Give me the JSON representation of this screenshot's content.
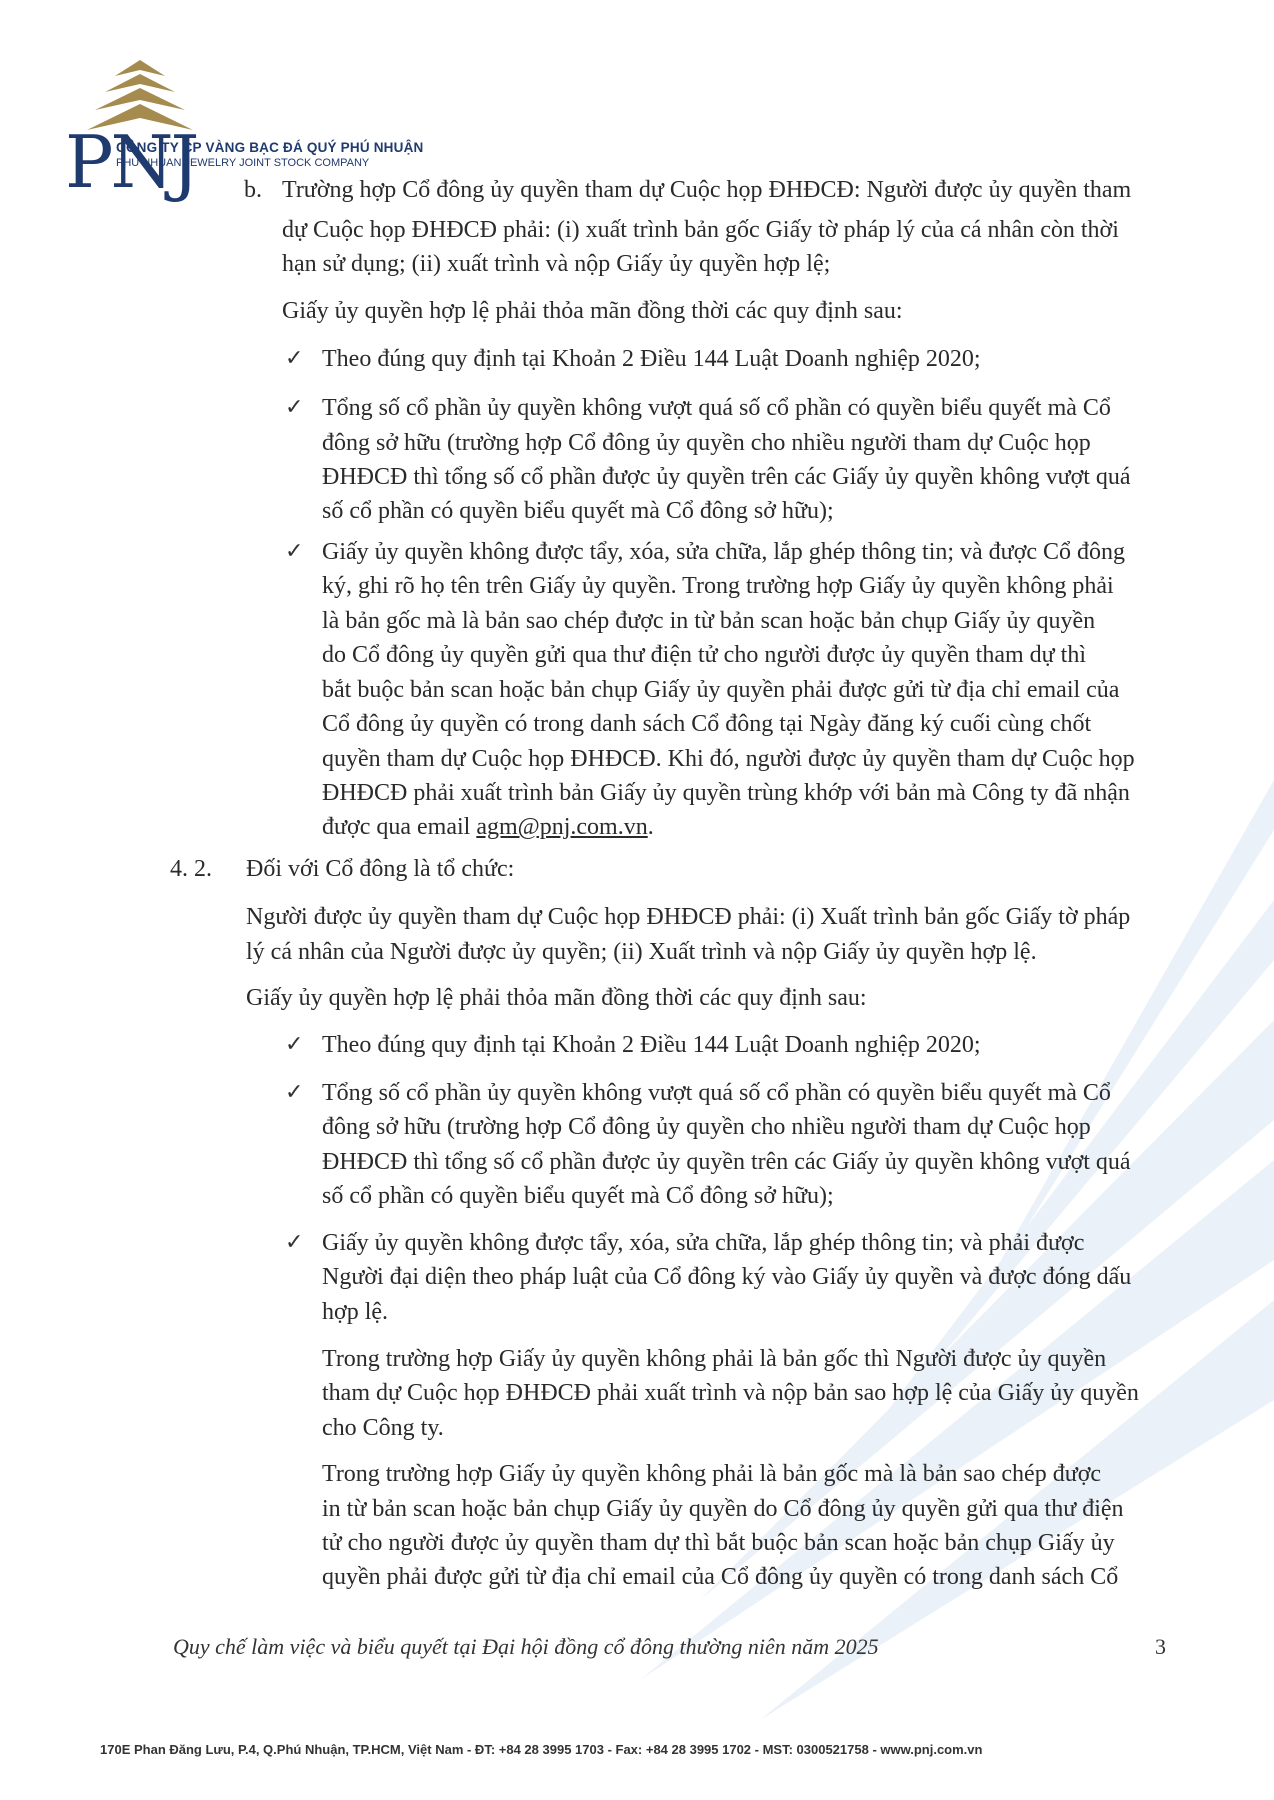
{
  "header": {
    "logo_text": "PNJ",
    "company_vn": "CÔNG TY CP VÀNG BẠC ĐÁ QUÝ PHÚ NHUẬN",
    "company_en": "PHU NHUAN JEWELRY JOINT STOCK COMPANY"
  },
  "section_b": {
    "label": "b.",
    "lines": [
      "Trường hợp Cổ đông ủy quyền tham dự Cuộc họp ĐHĐCĐ: Người được ủy quyền tham",
      "dự Cuộc họp ĐHĐCĐ phải: (i) xuất trình bản gốc Giấy tờ pháp lý của cá nhân còn thời",
      "hạn sử dụng; (ii) xuất trình và nộp Giấy ủy quyền hợp lệ;"
    ],
    "intro": "Giấy ủy quyền hợp lệ phải thỏa mãn đồng thời các quy định sau:",
    "bullets": [
      [
        "Theo đúng quy định tại Khoản 2 Điều 144 Luật Doanh nghiệp 2020;"
      ],
      [
        "Tổng số cổ phần ủy quyền không vượt quá số cổ phần có quyền biểu quyết mà Cổ",
        "đông sở hữu (trường hợp Cổ đông ủy quyền cho nhiều người tham dự Cuộc họp",
        "ĐHĐCĐ thì tổng số cổ phần được ủy quyền trên các Giấy ủy quyền không vượt quá",
        "số cổ phần có quyền biểu quyết mà Cổ đông sở hữu);"
      ],
      [
        "Giấy ủy quyền không được tẩy, xóa, sửa chữa, lắp ghép thông tin; và được Cổ đông",
        "ký, ghi rõ họ tên trên Giấy ủy quyền. Trong trường hợp Giấy ủy quyền không phải",
        "là bản gốc mà là bản sao chép được in từ bản scan hoặc bản chụp Giấy ủy quyền",
        "do Cổ đông ủy quyền gửi qua thư điện tử cho người được ủy quyền tham dự thì",
        "bắt buộc bản scan hoặc bản chụp Giấy ủy quyền phải được gửi từ địa chỉ email của",
        "Cổ đông ủy quyền có trong danh sách Cổ đông tại Ngày đăng ký cuối cùng chốt",
        "quyền tham dự Cuộc họp ĐHĐCĐ. Khi đó, người được ủy quyền tham dự Cuộc họp",
        "ĐHĐCĐ phải xuất trình bản Giấy ủy quyền trùng khớp với bản mà Công ty đã nhận"
      ]
    ],
    "last_prefix": "được qua email ",
    "email": "agm@pnj.com.vn",
    "last_suffix": "."
  },
  "section_42": {
    "number": "4. 2.",
    "heading": "Đối với Cổ đông là tổ chức:",
    "para1": [
      "Người được ủy quyền tham dự Cuộc họp ĐHĐCĐ phải: (i) Xuất trình bản gốc Giấy tờ pháp",
      "lý cá nhân của Người được ủy quyền; (ii) Xuất trình và nộp Giấy ủy quyền hợp lệ."
    ],
    "intro": "Giấy ủy quyền hợp lệ phải thỏa mãn đồng thời các quy định sau:",
    "bullets": [
      [
        "Theo đúng quy định tại Khoản 2 Điều 144 Luật Doanh nghiệp 2020;"
      ],
      [
        "Tổng số cổ phần ủy quyền không vượt quá số cổ phần có quyền biểu quyết mà Cổ",
        "đông sở hữu (trường hợp Cổ đông ủy quyền cho nhiều người tham dự Cuộc họp",
        "ĐHĐCĐ thì tổng số cổ phần được ủy quyền trên các Giấy ủy quyền không vượt quá",
        "số cổ phần có quyền biểu quyết mà Cổ đông sở hữu);"
      ],
      [
        "Giấy ủy quyền không được tẩy, xóa, sửa chữa, lắp ghép thông tin; và phải được",
        "Người đại diện theo pháp luật của Cổ đông ký vào Giấy ủy quyền và được đóng dấu",
        "hợp lệ."
      ]
    ],
    "para2": [
      "Trong trường hợp Giấy ủy quyền không phải là bản gốc thì Người được ủy quyền",
      "tham dự Cuộc họp ĐHĐCĐ phải xuất trình và nộp bản sao hợp lệ của Giấy ủy quyền",
      "cho Công ty."
    ],
    "para3": [
      "Trong trường hợp Giấy ủy quyền không phải là bản gốc mà là bản sao chép được",
      "in từ bản scan hoặc bản chụp Giấy ủy quyền do Cổ đông ủy quyền gửi qua thư điện",
      "tử cho người được ủy quyền tham dự thì bắt buộc bản scan hoặc bản chụp Giấy ủy",
      "quyền phải được gửi từ địa chỉ email của Cổ đông ủy quyền có trong danh sách Cổ"
    ]
  },
  "footer": {
    "title": "Quy chế làm việc và biểu quyết tại Đại hội đồng cổ đông thường niên năm 2025",
    "page": "3",
    "address": "170E Phan Đăng Lưu, P.4, Q.Phú Nhuận, TP.HCM, Việt Nam - ĐT: +84 28 3995 1703 - Fax: +84 28 3995 1702 - MST: 0300521758 - www.pnj.com.vn"
  },
  "colors": {
    "brand": "#1f3a6e",
    "gold": "#a68b4f",
    "watermark": "#dbe6f4"
  }
}
